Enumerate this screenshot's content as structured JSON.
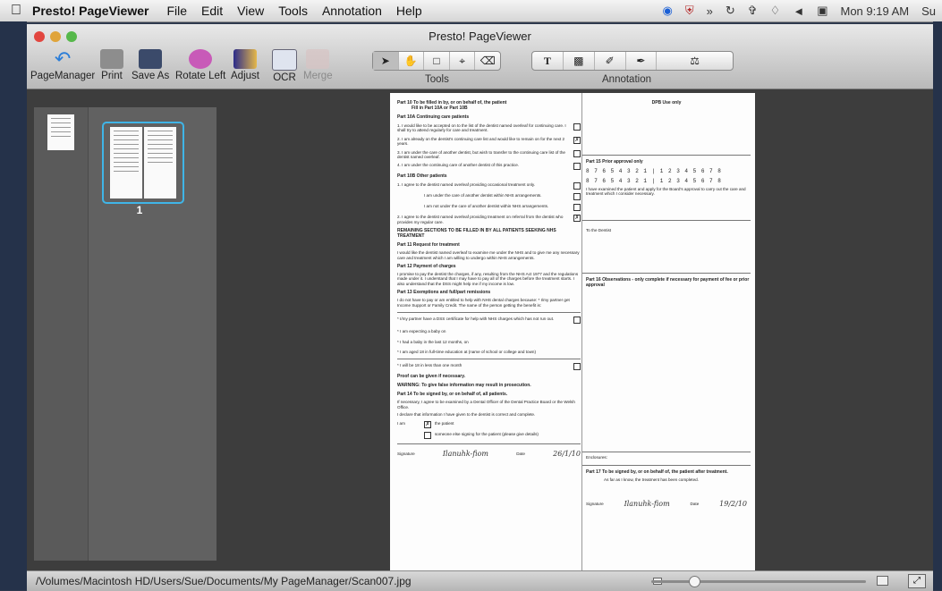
{
  "menubar": {
    "apple_icon": "apple-logo",
    "app_name": "Presto! PageViewer",
    "menus": [
      "File",
      "Edit",
      "View",
      "Tools",
      "Annotation",
      "Help"
    ],
    "clock": "Mon 9:19 AM",
    "user": "Su"
  },
  "window": {
    "title": "Presto! PageViewer",
    "toolbar": {
      "items": [
        {
          "label": "PageManager",
          "icon": "back-arrow-icon"
        },
        {
          "label": "Print",
          "icon": "printer-icon"
        },
        {
          "label": "Save As",
          "icon": "floppy-disk-icon"
        },
        {
          "label": "Rotate Left",
          "icon": "rotate-left-icon"
        },
        {
          "label": "Adjust",
          "icon": "adjust-image-icon"
        },
        {
          "label": "OCR",
          "icon": "ocr-icon"
        },
        {
          "label": "Merge",
          "icon": "merge-pdf-icon",
          "disabled": true
        }
      ],
      "tools_label": "Tools",
      "annotation_label": "Annotation",
      "tools": [
        "pointer",
        "hand",
        "select-rect",
        "crop",
        "eraser"
      ],
      "annotation_tools": [
        "text",
        "highlight",
        "pen",
        "marker",
        "stamp"
      ]
    }
  },
  "sidebar": {
    "page_number": "1"
  },
  "document": {
    "part10_title": "Part 10   To be filled in by, or on behalf of, the patient",
    "part10_sub": "Fill in Part 10A or Part 10B",
    "part10a": "Part 10A  Continuing care patients",
    "p1": "1. I would like to be accepted on to the list of the dentist named overleaf for continuing care. I shall try to attend regularly for care and treatment.",
    "p2": "2. I am already on the dentist's continuing care list and would like to remain on for the next 2 years.",
    "p3": "3. I am under the care of another dentist, but wish to transfer to the continuing care list of the dentist named overleaf.",
    "p4": "4. I am under the continuing care of another dentist of this practice.",
    "part10b": "Part 10B  Other patients",
    "p5": "1. I agree to the dentist named overleaf providing occasional treatment only.",
    "p6": "I am under the care of another dentist within NHS arrangements.",
    "p7": "I am not under the care of another dentist within NHS arrangements.",
    "p8": "2. I agree to the dentist named overleaf providing treatment on referral from the dentist who provides my regular care.",
    "remaining": "REMAINING SECTIONS TO BE FILLED IN BY ALL PATIENTS SEEKING NHS TREATMENT",
    "part11": "Part 11   Request for treatment",
    "part11_text": "I would like the dentist named overleaf to examine me under the NHS and to give me any necessary care and treatment which I am willing to undergo within NHS arrangements.",
    "part12": "Part 12   Payment of charges",
    "part12_text": "I promise to pay the dentist the charges, if any, resulting from the NHS Act 1977 and the regulations made under it. I understand that I may have to pay all of the charges before the treatment starts. I also understand that the DSS might help me if my income is low.",
    "part13": "Part 13   Exemptions and full/part remissions",
    "part13_text": "I do not have to pay or am entitled to help with NHS dental charges because: * I/my partner get Income Support or Family Credit. The name of the person getting the benefit is:",
    "e1": "* I/my partner have a DSS certificate for help with NHS charges which has not run out.",
    "e2": "* I am expecting a baby on",
    "e3": "* I had a baby in the last 12 months, on",
    "e4": "* I am aged 18 in full-time education at (name of school or college and town)",
    "e5": "* I will be 18 in less than one month",
    "proof": "Proof can be given if necessary.",
    "warning": "WARNING: To give false information may result in prosecution.",
    "part14": "Part 14   To be signed by, or on behalf of, all patients.",
    "part14_text": "If necessary, I agree to be examined by a Dental Officer of the Dental Practice Board or the Welsh Office.",
    "declare": "I declare that information I have given to the dentist is correct and complete.",
    "iam": "I am",
    "patient": "the patient",
    "someone": "someone else signing for the patient (please give details)",
    "signature_lbl": "Signature",
    "date_lbl": "Date",
    "sig_value": "Ilanuhk-fiom",
    "date_value": "26/1/10",
    "dpb": "DPB Use only",
    "part15": "Part 15   Prior approval only",
    "teeth_row": "8 7 6 5 4 3 2 1 | 1 2 3 4 5 6 7 8",
    "part15_text": "I have examined the patient and apply for the Board's approval to carry out the care and treatment which I consider necessary.",
    "to_dentist": "To the Dentist",
    "part16": "Part 16   Observations - only complete if necessary for payment of fee or prior approval",
    "enclosures": "Enclosures:",
    "part17": "Part 17   To be signed by, or on behalf of, the patient after treatment.",
    "part17_text": "As far as I know, the treatment has been completed.",
    "sig_value2": "Ilanuhk-fiom",
    "date_value2": "19/2/10"
  },
  "statusbar": {
    "path": "/Volumes/Macintosh HD/Users/Sue/Documents/My PageManager/Scan007.jpg",
    "zoom_fraction": 0.2
  }
}
